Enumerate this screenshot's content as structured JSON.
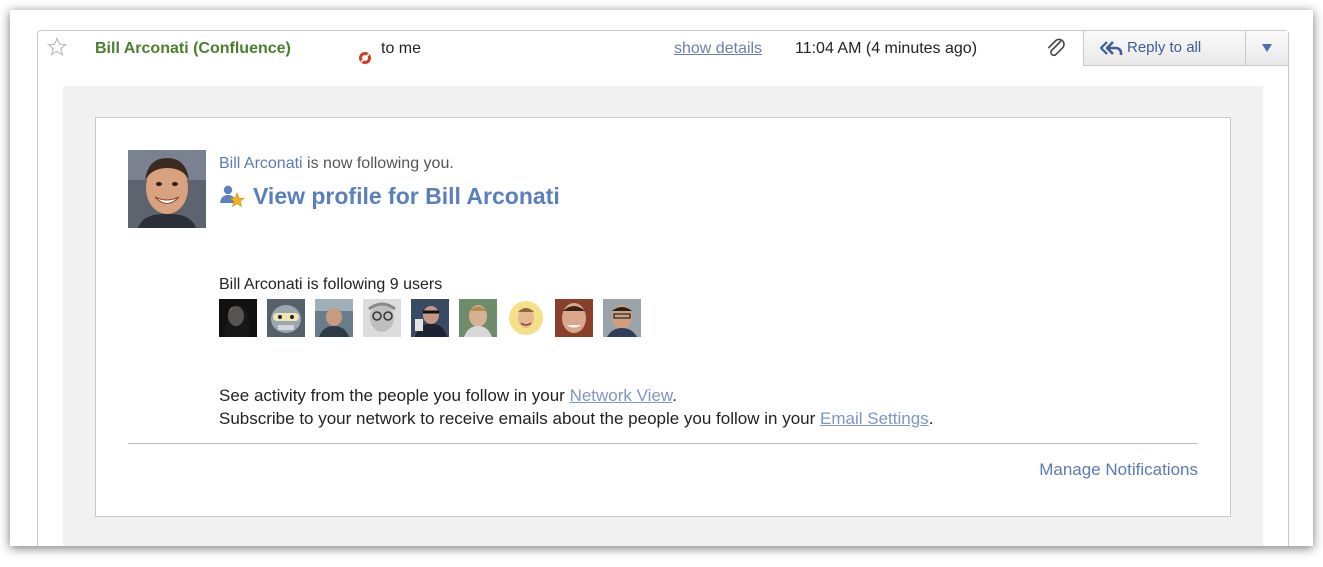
{
  "header": {
    "sender": "Bill Arconati (Confluence)",
    "recipient": "to me",
    "show_details": "show details",
    "time": "11:04 AM (4 minutes ago)",
    "reply_all": "Reply to all",
    "star_icon": "star-icon",
    "attachment_icon": "paperclip-icon"
  },
  "body": {
    "follower_name": "Bill Arconati",
    "follow_message": "is now following you.",
    "view_profile": "View profile for Bill Arconati",
    "following_count": "Bill Arconati is following 9 users",
    "activity_text": "See activity from the people you follow in your",
    "network_view": "Network View",
    "activity_end": ".",
    "subscribe_text": "Subscribe to your network to receive emails about the people you follow in your",
    "email_settings": "Email Settings",
    "subscribe_end": ".",
    "manage_notifications": "Manage Notifications"
  },
  "colors": {
    "sender_green": "#4a7f2e",
    "link_blue": "#5a7bb5",
    "reply_blue": "#3d5c99"
  }
}
